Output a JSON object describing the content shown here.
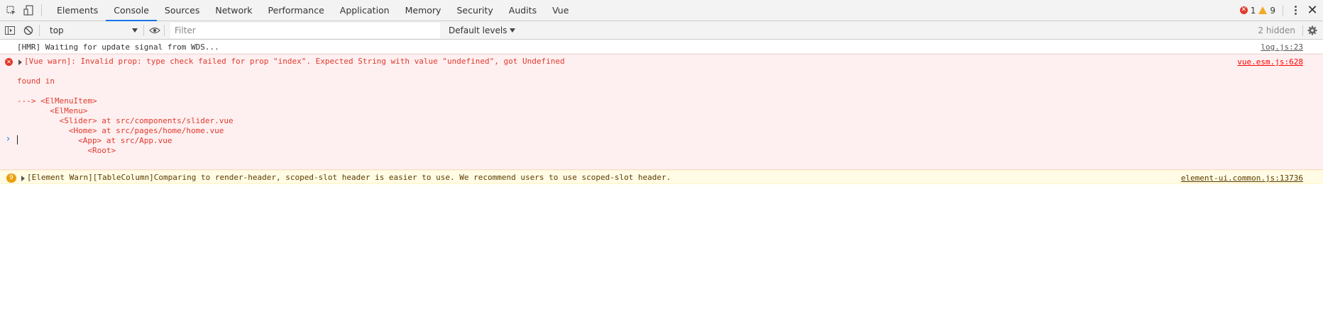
{
  "tabs": [
    {
      "label": "Elements"
    },
    {
      "label": "Console"
    },
    {
      "label": "Sources"
    },
    {
      "label": "Network"
    },
    {
      "label": "Performance"
    },
    {
      "label": "Application"
    },
    {
      "label": "Memory"
    },
    {
      "label": "Security"
    },
    {
      "label": "Audits"
    },
    {
      "label": "Vue"
    }
  ],
  "active_tab": "Console",
  "status": {
    "errors": "1",
    "warnings": "9"
  },
  "toolbar": {
    "context": "top",
    "filter_placeholder": "Filter",
    "levels": "Default levels",
    "hidden": "2 hidden"
  },
  "console": {
    "log": {
      "text": "[HMR] Waiting for update signal from WDS...",
      "source": "log.js:23"
    },
    "error": {
      "lines": [
        "[Vue warn]: Invalid prop: type check failed for prop \"index\". Expected String with value \"undefined\", got Undefined",
        "",
        "found in",
        "",
        "---> <ElMenuItem>",
        "       <ElMenu>",
        "         <Slider> at src/components/slider.vue",
        "           <Home> at src/pages/home/home.vue",
        "             <App> at src/App.vue",
        "               <Root>"
      ],
      "source": "vue.esm.js:628"
    },
    "warn": {
      "count": "9",
      "text": "[Element Warn][TableColumn]Comparing to render-header, scoped-slot header is easier to use. We recommend users to use scoped-slot header.",
      "source": "element-ui.common.js:13736"
    },
    "prompt": "›"
  },
  "colors": {
    "accent": "#1a73e8",
    "error_bg": "#fef0f0",
    "error_text": "#e0392e",
    "warn_bg": "#fffbe5",
    "warn_badge": "#e8a10c"
  }
}
